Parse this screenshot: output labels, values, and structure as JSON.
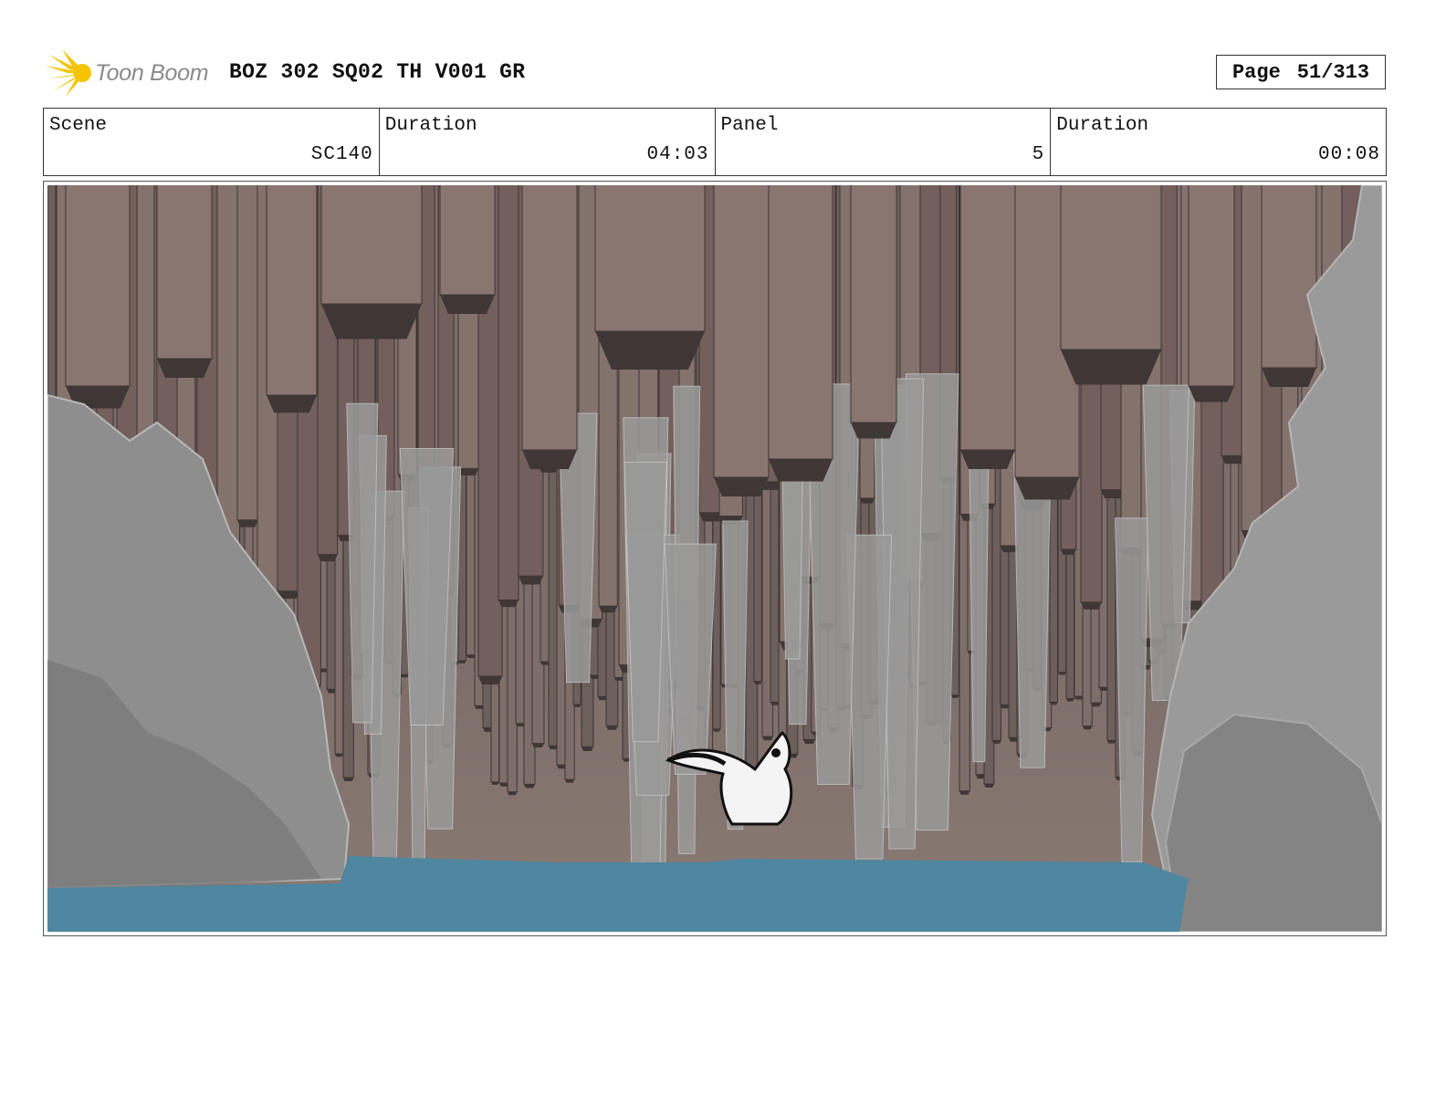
{
  "header": {
    "logo_text": "Toon Boom",
    "title": "BOZ 302 SQ02 TH V001 GR",
    "page_label": "Page",
    "page_value": "51/313"
  },
  "info": [
    {
      "label": "Scene",
      "value": "SC140"
    },
    {
      "label": "Duration",
      "value": "04:03"
    },
    {
      "label": "Panel",
      "value": "5"
    },
    {
      "label": "Duration",
      "value": "00:08"
    }
  ],
  "colors": {
    "logo_yellow": "#f5c400",
    "pillar": "#7a6a66",
    "pillar_dark": "#4a413f",
    "rock": "#8c8c8c",
    "water": "#4f86a0"
  }
}
